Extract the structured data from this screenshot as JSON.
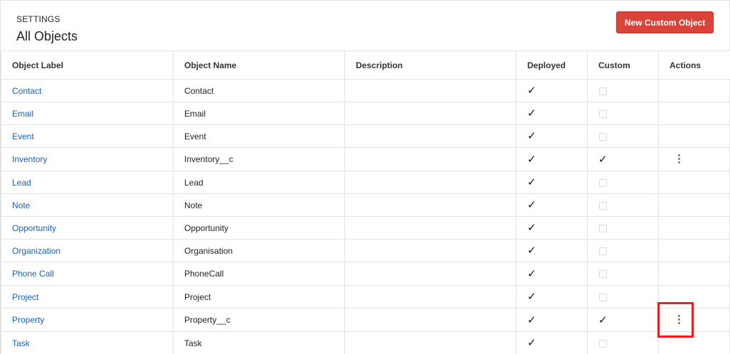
{
  "header": {
    "eyebrow": "SETTINGS",
    "title": "All Objects",
    "new_button_label": "New Custom Object"
  },
  "colors": {
    "accent": "#d9433a",
    "link": "#1a5fb4",
    "highlight": "#ee1c1c"
  },
  "table": {
    "columns": [
      "Object Label",
      "Object Name",
      "Description",
      "Deployed",
      "Custom",
      "Actions"
    ],
    "rows": [
      {
        "label": "Contact",
        "name": "Contact",
        "description": "",
        "deployed": true,
        "custom": false,
        "actions": false
      },
      {
        "label": "Email",
        "name": "Email",
        "description": "",
        "deployed": true,
        "custom": false,
        "actions": false
      },
      {
        "label": "Event",
        "name": "Event",
        "description": "",
        "deployed": true,
        "custom": false,
        "actions": false
      },
      {
        "label": "Inventory",
        "name": "Inventory__c",
        "description": "",
        "deployed": true,
        "custom": true,
        "actions": true
      },
      {
        "label": "Lead",
        "name": "Lead",
        "description": "",
        "deployed": true,
        "custom": false,
        "actions": false
      },
      {
        "label": "Note",
        "name": "Note",
        "description": "",
        "deployed": true,
        "custom": false,
        "actions": false
      },
      {
        "label": "Opportunity",
        "name": "Opportunity",
        "description": "",
        "deployed": true,
        "custom": false,
        "actions": false
      },
      {
        "label": "Organization",
        "name": "Organisation",
        "description": "",
        "deployed": true,
        "custom": false,
        "actions": false
      },
      {
        "label": "Phone Call",
        "name": "PhoneCall",
        "description": "",
        "deployed": true,
        "custom": false,
        "actions": false
      },
      {
        "label": "Project",
        "name": "Project",
        "description": "",
        "deployed": true,
        "custom": false,
        "actions": false
      },
      {
        "label": "Property",
        "name": "Property__c",
        "description": "",
        "deployed": true,
        "custom": true,
        "actions": true
      },
      {
        "label": "Task",
        "name": "Task",
        "description": "",
        "deployed": true,
        "custom": false,
        "actions": false
      }
    ]
  },
  "icons": {
    "check": "check-icon",
    "empty_checkbox": "checkbox-empty-icon",
    "actions_menu": "more-vertical-icon"
  }
}
